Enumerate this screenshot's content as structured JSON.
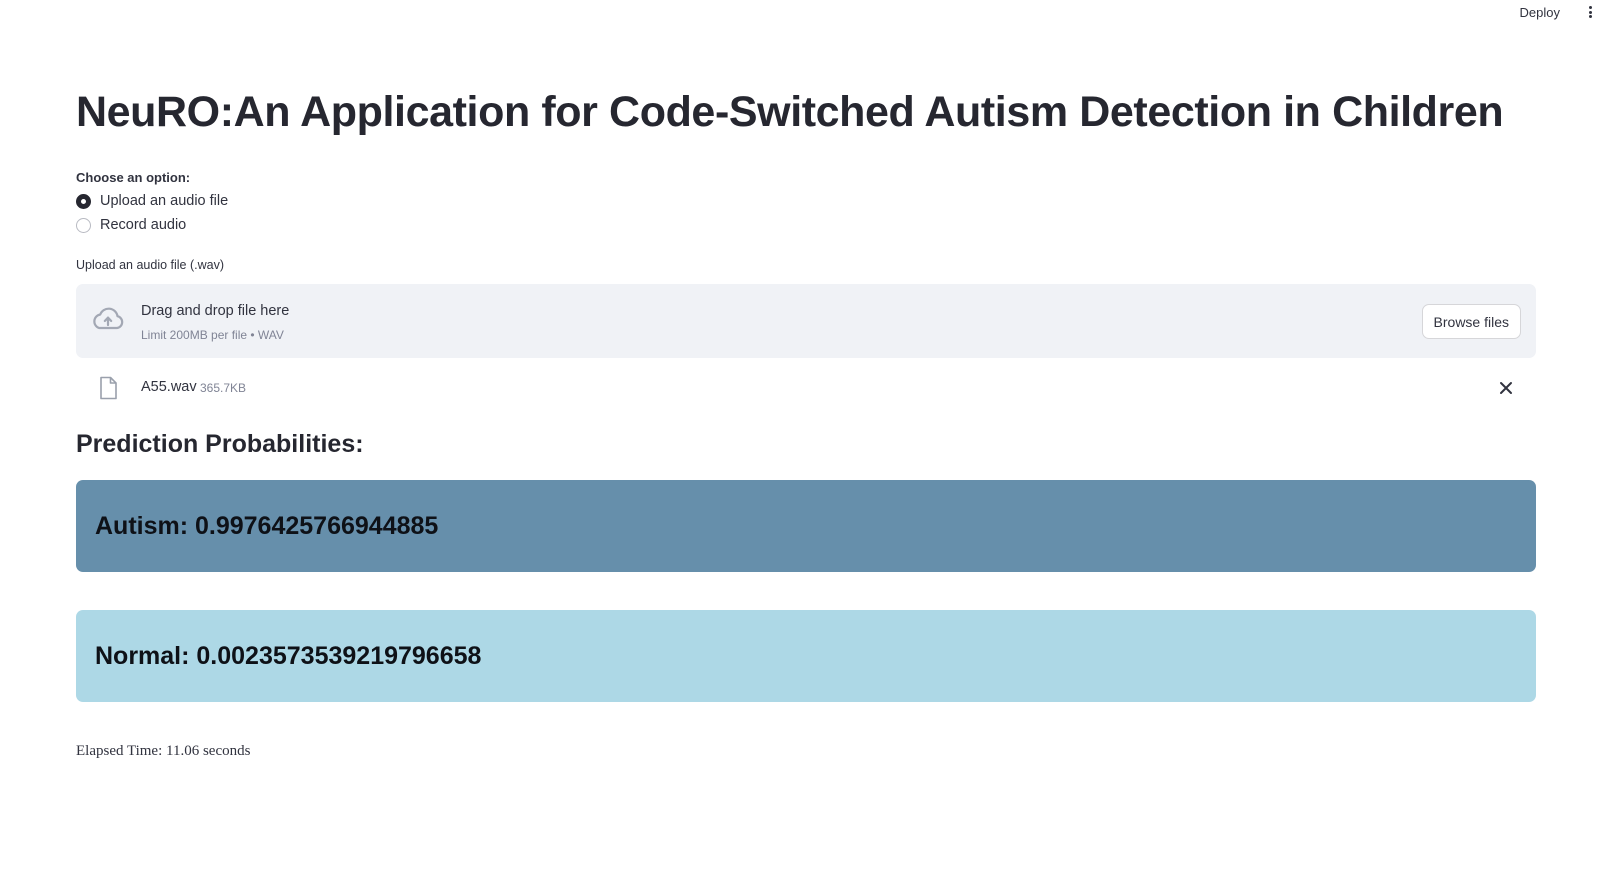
{
  "toolbar": {
    "deploy_label": "Deploy",
    "menu_icon": "kebab-menu-icon"
  },
  "page": {
    "title": "NeuRO:An Application for Code-Switched Autism Detection in Children"
  },
  "options": {
    "label": "Choose an option:",
    "items": [
      {
        "label": "Upload an audio file",
        "selected": true
      },
      {
        "label": "Record audio",
        "selected": false
      }
    ]
  },
  "uploader": {
    "label": "Upload an audio file (.wav)",
    "dropzone_text": "Drag and drop file here",
    "limit_text": "Limit 200MB per file • WAV",
    "browse_label": "Browse files",
    "icon": "cloud-upload-icon"
  },
  "file": {
    "name": "A55.wav",
    "size": "365.7KB",
    "icon": "file-icon",
    "remove_icon": "close-icon"
  },
  "predictions": {
    "heading": "Prediction Probabilities:",
    "autism": "Autism: 0.9976425766944885",
    "normal": "Normal: 0.0023573539219796658"
  },
  "colors": {
    "autism_box": "#668fab",
    "normal_box": "#add8e6",
    "dropzone_bg": "#f0f2f6"
  },
  "elapsed": "Elapsed Time: 11.06 seconds"
}
